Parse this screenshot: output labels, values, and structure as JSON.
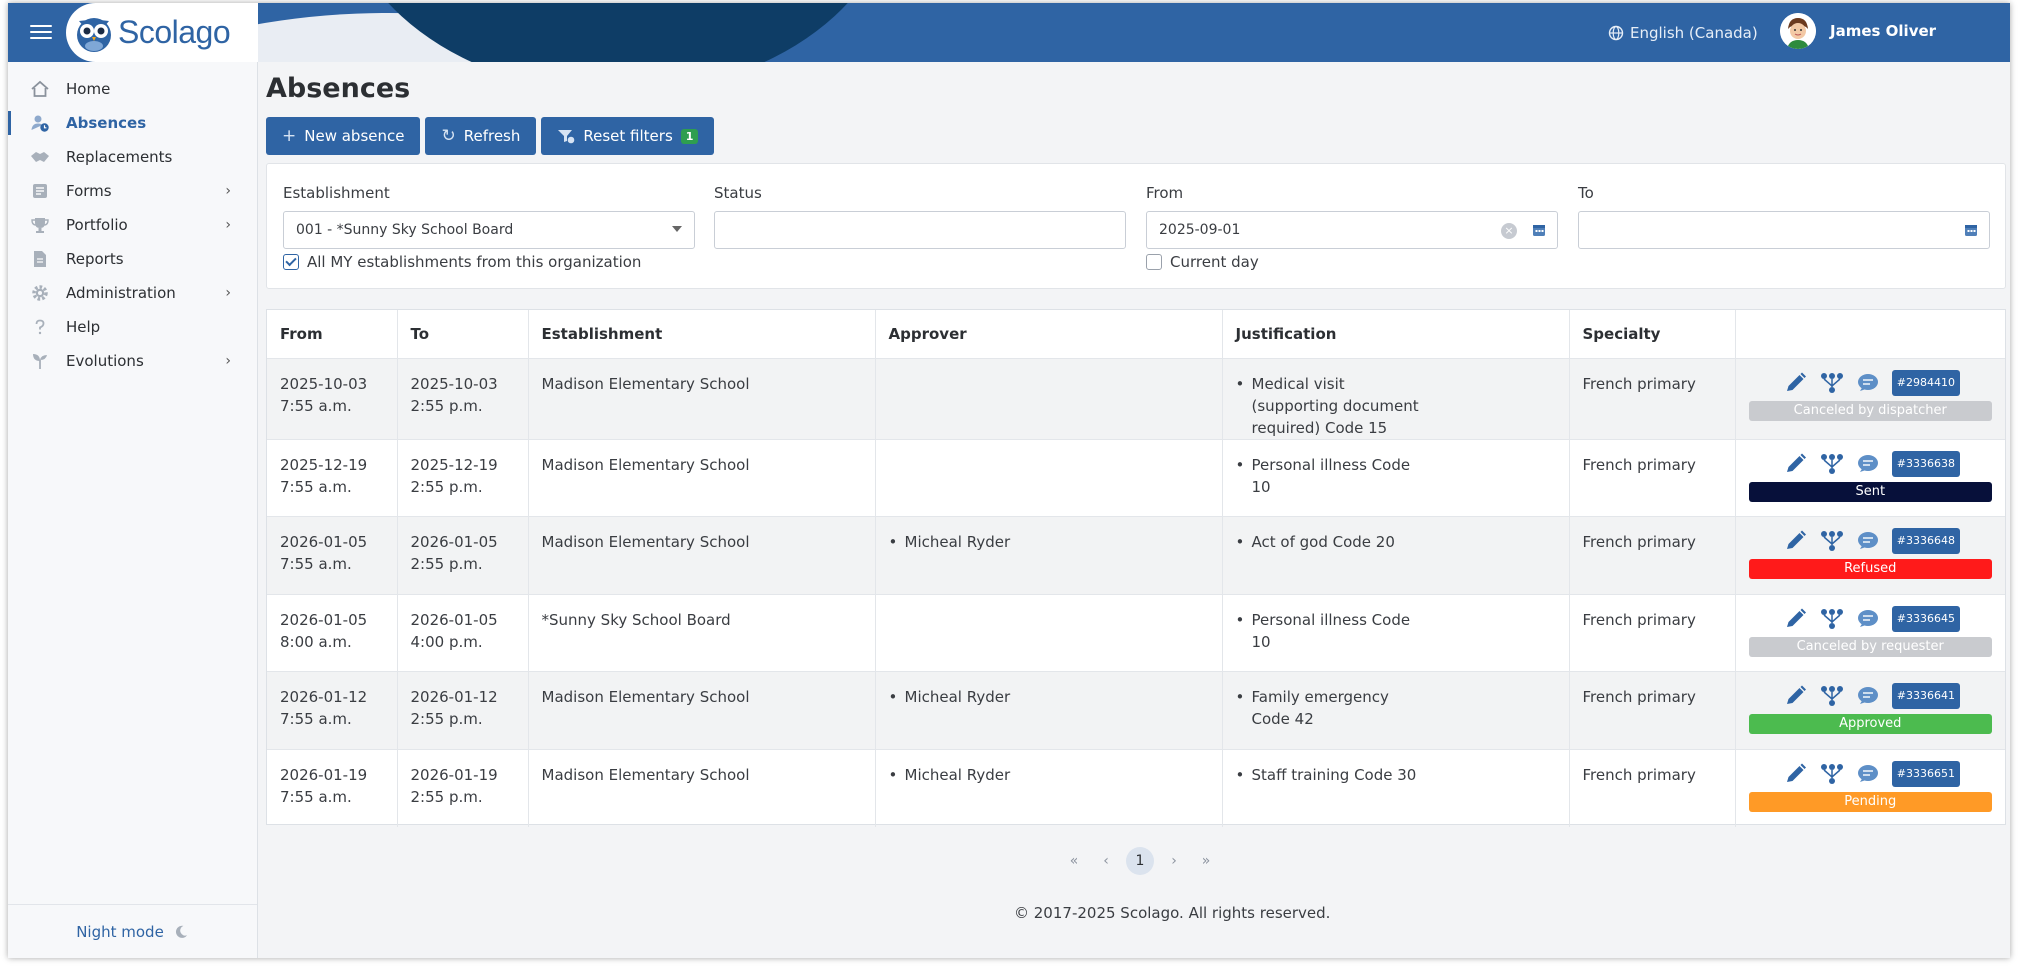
{
  "app": {
    "name": "Scolago",
    "language": "English (Canada)",
    "user_name": "James Oliver"
  },
  "sidebar": {
    "items": [
      {
        "label": "Home",
        "icon": "home-icon",
        "has_submenu": false,
        "active": false
      },
      {
        "label": "Absences",
        "icon": "user-clock-icon",
        "has_submenu": false,
        "active": true
      },
      {
        "label": "Replacements",
        "icon": "handshake-icon",
        "has_submenu": false,
        "active": false
      },
      {
        "label": "Forms",
        "icon": "form-list-icon",
        "has_submenu": true,
        "active": false
      },
      {
        "label": "Portfolio",
        "icon": "trophy-icon",
        "has_submenu": true,
        "active": false
      },
      {
        "label": "Reports",
        "icon": "report-icon",
        "has_submenu": false,
        "active": false
      },
      {
        "label": "Administration",
        "icon": "gear-icon",
        "has_submenu": true,
        "active": false
      },
      {
        "label": "Help",
        "icon": "question-icon",
        "has_submenu": false,
        "active": false
      },
      {
        "label": "Evolutions",
        "icon": "sprout-icon",
        "has_submenu": true,
        "active": false
      }
    ],
    "night_mode_label": "Night mode"
  },
  "page": {
    "title": "Absences",
    "buttons": {
      "new_absence": "New absence",
      "refresh": "Refresh",
      "reset_filters": "Reset filters",
      "reset_filters_count": "1"
    }
  },
  "filters": {
    "establishment": {
      "label": "Establishment",
      "value": "001 - *Sunny Sky School Board"
    },
    "all_my_establishments": {
      "label": "All MY establishments from this organization",
      "checked": true
    },
    "status": {
      "label": "Status",
      "value": ""
    },
    "from": {
      "label": "From",
      "value": "2025-09-01"
    },
    "current_day": {
      "label": "Current day",
      "checked": false
    },
    "to": {
      "label": "To",
      "value": ""
    }
  },
  "table": {
    "headers": [
      "From",
      "To",
      "Establishment",
      "Approver",
      "Justification",
      "Specialty",
      ""
    ],
    "rows": [
      {
        "from_date": "2025-10-03",
        "from_time": "7:55 a.m.",
        "to_date": "2025-10-03",
        "to_time": "2:55 p.m.",
        "establishment": "Madison Elementary School",
        "approver": "",
        "justification": "Medical visit (supporting document required) Code 15",
        "specialty": "French primary",
        "id": "#2984410",
        "status": "Canceled by dispatcher",
        "status_color": "#c9cbcf"
      },
      {
        "from_date": "2025-12-19",
        "from_time": "7:55 a.m.",
        "to_date": "2025-12-19",
        "to_time": "2:55 p.m.",
        "establishment": "Madison Elementary School",
        "approver": "",
        "justification": "Personal illness Code 10",
        "specialty": "French primary",
        "id": "#3336638",
        "status": "Sent",
        "status_color": "#07103a"
      },
      {
        "from_date": "2026-01-05",
        "from_time": "7:55 a.m.",
        "to_date": "2026-01-05",
        "to_time": "2:55 p.m.",
        "establishment": "Madison Elementary School",
        "approver": "Micheal Ryder",
        "justification": "Act of god Code 20",
        "specialty": "French primary",
        "id": "#3336648",
        "status": "Refused",
        "status_color": "#ff1a1a"
      },
      {
        "from_date": "2026-01-05",
        "from_time": "8:00 a.m.",
        "to_date": "2026-01-05",
        "to_time": "4:00 p.m.",
        "establishment": "*Sunny Sky School Board",
        "approver": "",
        "justification": "Personal illness Code 10",
        "specialty": "French primary",
        "id": "#3336645",
        "status": "Canceled by requester",
        "status_color": "#c9cbcf"
      },
      {
        "from_date": "2026-01-12",
        "from_time": "7:55 a.m.",
        "to_date": "2026-01-12",
        "to_time": "2:55 p.m.",
        "establishment": "Madison Elementary School",
        "approver": "Micheal Ryder",
        "justification": "Family emergency Code 42",
        "specialty": "French primary",
        "id": "#3336641",
        "status": "Approved",
        "status_color": "#4cbb4f"
      },
      {
        "from_date": "2026-01-19",
        "from_time": "7:55 a.m.",
        "to_date": "2026-01-19",
        "to_time": "2:55 p.m.",
        "establishment": "Madison Elementary School",
        "approver": "Micheal Ryder",
        "justification": "Staff training Code 30",
        "specialty": "French primary",
        "id": "#3336651",
        "status": "Pending",
        "status_color": "#ff9a26"
      }
    ]
  },
  "pagination": {
    "current_page": "1"
  },
  "footer": {
    "text": "© 2017-2025 Scolago. All rights reserved."
  },
  "colors": {
    "brand": "#2f64a4",
    "brand_dark": "#0e3d66"
  }
}
